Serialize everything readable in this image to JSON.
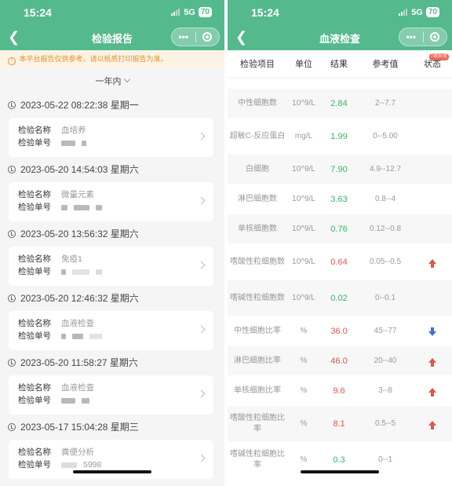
{
  "left": {
    "time": "15:24",
    "network": "5G",
    "battery": "70",
    "title": "检验报告",
    "capsule_more": "•••",
    "notice_icon": "!",
    "notice": "本平台报告仅供参考，请以纸质打印报告为准。",
    "filter": "一年内",
    "name_label": "检验名称",
    "id_label": "检验单号",
    "reports": [
      {
        "date": "2023-05-22 08:22:38 星期一",
        "name": "血培养",
        "id": ""
      },
      {
        "date": "2023-05-20 14:54:03 星期六",
        "name": "微量元素",
        "id": ""
      },
      {
        "date": "2023-05-20 13:56:32 星期六",
        "name": "免疫1",
        "id": ""
      },
      {
        "date": "2023-05-20 12:46:32 星期六",
        "name": "血液检查",
        "id": ""
      },
      {
        "date": "2023-05-20 11:58:27 星期六",
        "name": "血液检查",
        "id": ""
      },
      {
        "date": "2023-05-17 15:04:28 星期三",
        "name": "粪便分析",
        "id": "5998"
      }
    ]
  },
  "right": {
    "time": "15:24",
    "network": "5G",
    "battery": "70",
    "title": "血液检查",
    "capsule_more": "•••",
    "headers": {
      "item": "检验项目",
      "unit": "单位",
      "result": "结果",
      "reference": "参考值",
      "status": "状态",
      "badge": "7项异常"
    },
    "rows": [
      {
        "item": "中性细胞数",
        "unit": "10^9/L",
        "result": "2.84",
        "reference": "2--7.7",
        "status": "normal"
      },
      {
        "item": "超敏C-反应蛋白",
        "unit": "mg/L",
        "result": "1.99",
        "reference": "0--5.00",
        "status": "normal"
      },
      {
        "item": "白细胞",
        "unit": "10^9/L",
        "result": "7.90",
        "reference": "4.9--12.7",
        "status": "normal"
      },
      {
        "item": "淋巴细胞数",
        "unit": "10^9/L",
        "result": "3.63",
        "reference": "0.8--4",
        "status": "normal"
      },
      {
        "item": "单核细胞数",
        "unit": "10^9/L",
        "result": "0.76",
        "reference": "0.12--0.8",
        "status": "normal"
      },
      {
        "item": "嗜酸性粒细胞数",
        "unit": "10^9/L",
        "result": "0.64",
        "reference": "0.05--0.5",
        "status": "high"
      },
      {
        "item": "嗜碱性粒细胞数",
        "unit": "10^9/L",
        "result": "0.02",
        "reference": "0--0.1",
        "status": "normal"
      },
      {
        "item": "中性细胞比率",
        "unit": "%",
        "result": "36.0",
        "reference": "45--77",
        "status": "low"
      },
      {
        "item": "淋巴细胞比率",
        "unit": "%",
        "result": "46.0",
        "reference": "20--40",
        "status": "high"
      },
      {
        "item": "单核细胞比率",
        "unit": "%",
        "result": "9.6",
        "reference": "3--8",
        "status": "high"
      },
      {
        "item": "嗜酸性粒细胞比率",
        "unit": "%",
        "result": "8.1",
        "reference": "0.5--5",
        "status": "high"
      },
      {
        "item": "嗜碱性粒细胞比率",
        "unit": "%",
        "result": "0.3",
        "reference": "0--1",
        "status": "normal"
      }
    ]
  },
  "colors": {
    "header_green": "#54b98d",
    "normal": "#35b66a",
    "abnormal": "#e45448",
    "low_arrow": "#3d6ee0",
    "notice": "#e8902a"
  }
}
